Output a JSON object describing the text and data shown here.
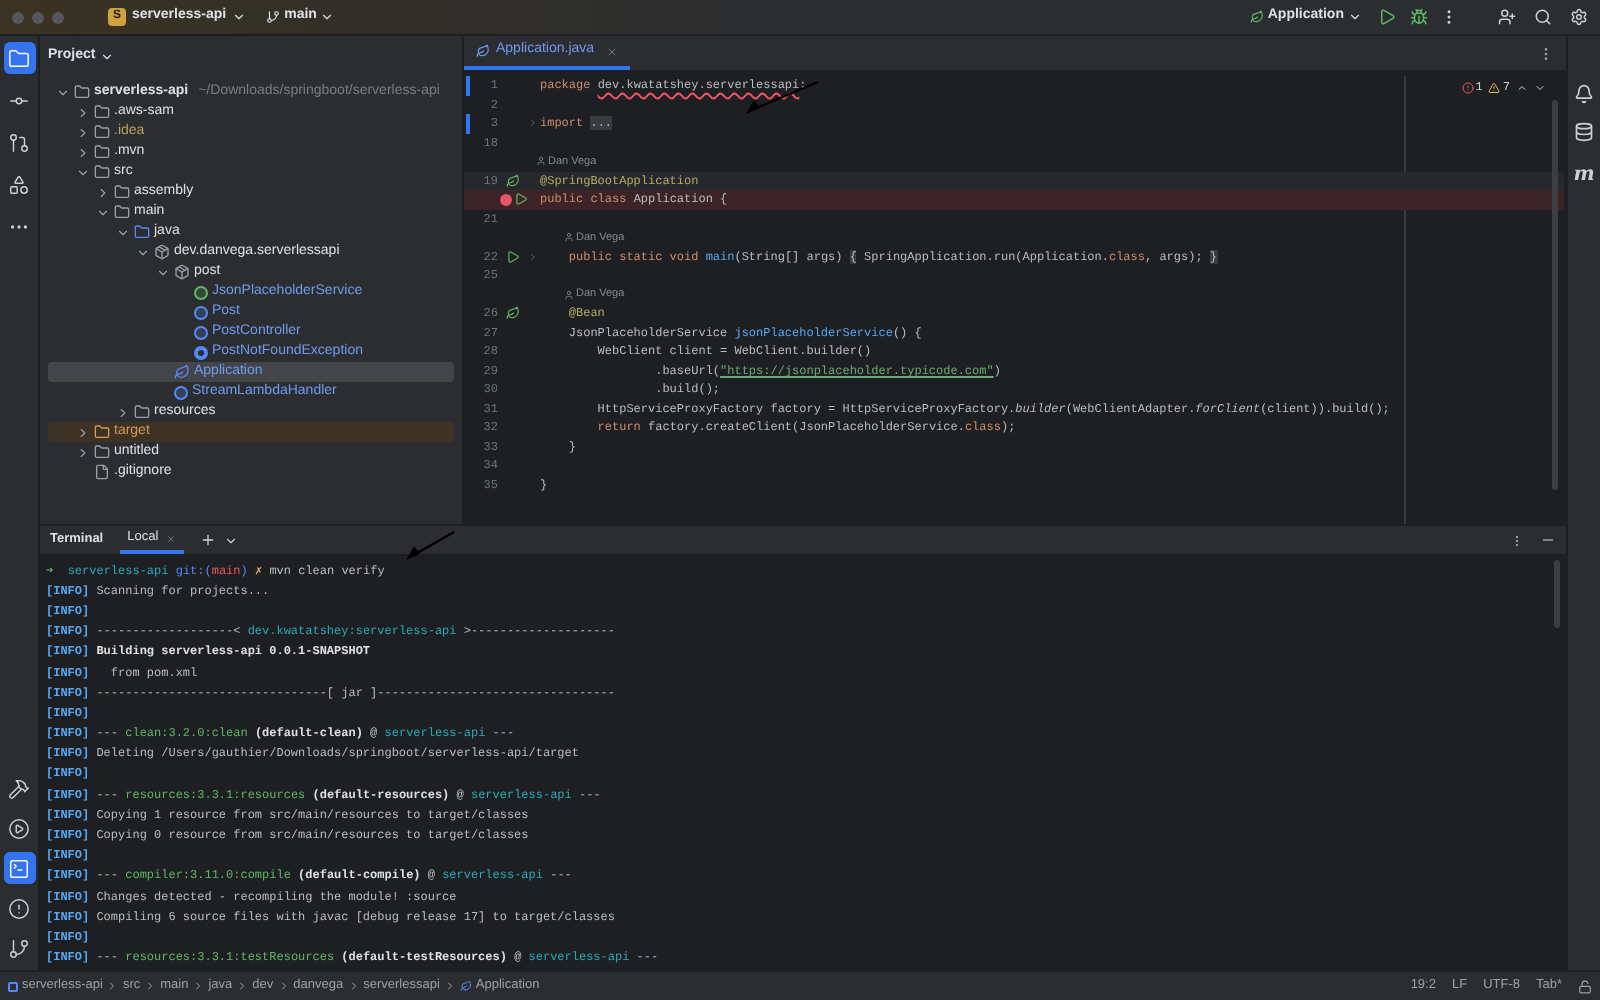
{
  "title_bar": {
    "project_badge": "S",
    "project": "serverless-api",
    "branch": "main",
    "run_config": "Application"
  },
  "left_strip": {
    "top": [
      {
        "kind": "project",
        "selected": true
      },
      {
        "kind": "commit",
        "selected": false
      },
      {
        "kind": "pull_requests",
        "selected": false
      },
      {
        "kind": "structure",
        "selected": false
      },
      {
        "kind": "more",
        "selected": false
      }
    ],
    "bottom": [
      {
        "kind": "build",
        "selected": false
      },
      {
        "kind": "services",
        "selected": false
      },
      {
        "kind": "terminal",
        "selected": true
      },
      {
        "kind": "problems",
        "selected": false
      },
      {
        "kind": "git",
        "selected": false
      }
    ]
  },
  "right_strip": {
    "items": [
      {
        "kind": "notifications"
      },
      {
        "kind": "database"
      },
      {
        "kind": "maven",
        "label": "m"
      }
    ]
  },
  "project": {
    "title": "Project",
    "tree": [
      {
        "label": "serverless-api",
        "kind": "module",
        "hint": "~/Downloads/springboot/serverless-api",
        "expanded": true,
        "selected": false,
        "color": "#dfe1e5",
        "children": [
          {
            "label": ".aws-sam",
            "kind": "folder",
            "expanded": false,
            "selected": false,
            "color": "#dfe1e5"
          },
          {
            "label": ".idea",
            "kind": "folder",
            "expanded": false,
            "selected": false,
            "color": "#b5a55e"
          },
          {
            "label": ".mvn",
            "kind": "folder",
            "expanded": false,
            "selected": false,
            "color": "#dfe1e5"
          },
          {
            "label": "src",
            "kind": "folder",
            "expanded": true,
            "selected": false,
            "color": "#dfe1e5",
            "children": [
              {
                "label": "assembly",
                "kind": "folder",
                "expanded": false,
                "selected": false,
                "color": "#dfe1e5"
              },
              {
                "label": "main",
                "kind": "folder",
                "expanded": true,
                "selected": false,
                "color": "#dfe1e5",
                "children": [
                  {
                    "label": "java",
                    "kind": "source_folder",
                    "expanded": true,
                    "selected": false,
                    "color": "#dfe1e5",
                    "children": [
                      {
                        "label": "dev.danvega.serverlessapi",
                        "kind": "package",
                        "expanded": true,
                        "selected": false,
                        "color": "#dfe1e5",
                        "children": [
                          {
                            "label": "post",
                            "kind": "package",
                            "expanded": true,
                            "selected": false,
                            "color": "#dfe1e5",
                            "children": [
                              {
                                "label": "JsonPlaceholderService",
                                "kind": "interface",
                                "selected": false,
                                "color": "#6f9cf0"
                              },
                              {
                                "label": "Post",
                                "kind": "class",
                                "selected": false,
                                "color": "#6f9cf0"
                              },
                              {
                                "label": "PostController",
                                "kind": "class",
                                "selected": false,
                                "color": "#6f9cf0"
                              },
                              {
                                "label": "PostNotFoundException",
                                "kind": "exception",
                                "selected": false,
                                "color": "#6f9cf0"
                              }
                            ]
                          },
                          {
                            "label": "Application",
                            "kind": "spring_class",
                            "selected": true,
                            "color": "#6f9cf0"
                          },
                          {
                            "label": "StreamLambdaHandler",
                            "kind": "class",
                            "selected": false,
                            "color": "#6f9cf0"
                          }
                        ]
                      }
                    ]
                  },
                  {
                    "label": "resources",
                    "kind": "resource_folder",
                    "expanded": false,
                    "selected": false,
                    "color": "#dfe1e5"
                  }
                ]
              }
            ]
          },
          {
            "label": "target",
            "kind": "excluded_folder",
            "expanded": false,
            "selected": false,
            "color": "#d29a5c"
          },
          {
            "label": "untitled",
            "kind": "folder",
            "expanded": false,
            "selected": false,
            "color": "#dfe1e5"
          },
          {
            "label": ".gitignore",
            "kind": "ignore_file",
            "selected": false,
            "color": "#dfe1e5"
          }
        ]
      }
    ]
  },
  "editor": {
    "tabs": [
      {
        "label": "Application.java",
        "selected": true
      }
    ],
    "errors": "1",
    "warnings": "7",
    "lines": [
      {
        "kind": "code",
        "number": "1",
        "marks": [
          {
            "kind": "changed"
          }
        ],
        "segments": [
          {
            "kind": "kw",
            "t": "package "
          },
          {
            "kind": "error",
            "t": "dev.kwatatshey.serverlessapi"
          },
          {
            "kind": "plain",
            "t": ";"
          }
        ]
      },
      {
        "kind": "code",
        "number": "2"
      },
      {
        "kind": "code",
        "number": "3",
        "marks": [
          {
            "kind": "changed"
          },
          {
            "kind": "fold"
          }
        ],
        "segments": [
          {
            "kind": "kw",
            "t": "import "
          },
          {
            "kind": "folded",
            "t": "..."
          }
        ]
      },
      {
        "kind": "code",
        "number": "18"
      },
      {
        "kind": "author",
        "nested": false,
        "text": "Dan Vega"
      },
      {
        "kind": "current_line",
        "number": "19",
        "marks": [
          {
            "kind": "spring"
          }
        ],
        "segments": [
          {
            "kind": "annotation",
            "t": "@SpringBootApplication"
          }
        ]
      },
      {
        "kind": "error_line",
        "marks": [
          {
            "kind": "breakpoint"
          },
          {
            "kind": "run"
          }
        ],
        "segments": [
          {
            "kind": "kw",
            "t": "public class "
          },
          {
            "kind": "plain",
            "t": "Application {"
          }
        ]
      },
      {
        "kind": "code",
        "number": "21"
      },
      {
        "kind": "author",
        "nested": true,
        "text": "Dan Vega"
      },
      {
        "kind": "code",
        "number": "22",
        "marks": [
          {
            "kind": "run"
          },
          {
            "kind": "fold"
          }
        ],
        "segments": [
          {
            "kind": "kw",
            "t": "    public static void "
          },
          {
            "kind": "method",
            "t": "main"
          },
          {
            "kind": "plain",
            "t": "(String[] args) "
          },
          {
            "kind": "folded",
            "t": "{"
          },
          {
            "kind": "plain",
            "t": " SpringApplication.run(Application."
          },
          {
            "kind": "kw",
            "t": "class"
          },
          {
            "kind": "plain",
            "t": ", args); "
          },
          {
            "kind": "folded",
            "t": "}"
          }
        ]
      },
      {
        "kind": "code",
        "number": "25"
      },
      {
        "kind": "author",
        "nested": true,
        "text": "Dan Vega"
      },
      {
        "kind": "code",
        "number": "26",
        "marks": [
          {
            "kind": "bean"
          }
        ],
        "segments": [
          {
            "kind": "annotation",
            "t": "    @Bean"
          }
        ]
      },
      {
        "kind": "code",
        "number": "27",
        "segments": [
          {
            "kind": "plain",
            "t": "    JsonPlaceholderService "
          },
          {
            "kind": "method",
            "t": "jsonPlaceholderService"
          },
          {
            "kind": "plain",
            "t": "() {"
          }
        ]
      },
      {
        "kind": "code",
        "number": "28",
        "segments": [
          {
            "kind": "plain",
            "t": "        WebClient client = WebClient.builder()"
          }
        ]
      },
      {
        "kind": "code",
        "number": "29",
        "segments": [
          {
            "kind": "plain",
            "t": "                .baseUrl("
          },
          {
            "kind": "string",
            "t": "\"https://jsonplaceholder.typicode.com\""
          },
          {
            "kind": "plain",
            "t": ")"
          }
        ]
      },
      {
        "kind": "code",
        "number": "30",
        "segments": [
          {
            "kind": "plain",
            "t": "                .build();"
          }
        ]
      },
      {
        "kind": "code",
        "number": "31",
        "segments": [
          {
            "kind": "plain",
            "t": "        HttpServiceProxyFactory factory = HttpServiceProxyFactory."
          },
          {
            "kind": "italic",
            "t": "builder"
          },
          {
            "kind": "plain",
            "t": "(WebClientAdapter."
          },
          {
            "kind": "italic",
            "t": "forClient"
          },
          {
            "kind": "plain",
            "t": "(client)).build();"
          }
        ]
      },
      {
        "kind": "code",
        "number": "32",
        "segments": [
          {
            "kind": "kw",
            "t": "        return "
          },
          {
            "kind": "plain",
            "t": "factory.createClient(JsonPlaceholderService."
          },
          {
            "kind": "kw",
            "t": "class"
          },
          {
            "kind": "plain",
            "t": ");"
          }
        ]
      },
      {
        "kind": "code",
        "number": "33",
        "segments": [
          {
            "kind": "plain",
            "t": "    }"
          }
        ]
      },
      {
        "kind": "code",
        "number": "34"
      },
      {
        "kind": "code",
        "number": "35",
        "segments": [
          {
            "kind": "plain",
            "t": "}"
          }
        ]
      }
    ]
  },
  "terminal": {
    "title": "Terminal",
    "tabs": [
      {
        "label": "Local",
        "selected": true
      }
    ],
    "lines": [
      [
        {
          "kind": "arrow",
          "t": "➜  "
        },
        {
          "kind": "teal",
          "t": "serverless-api "
        },
        {
          "kind": "blue",
          "t": "git:("
        },
        {
          "kind": "red",
          "t": "main"
        },
        {
          "kind": "blue",
          "t": ") "
        },
        {
          "kind": "yellow",
          "t": "✗ "
        },
        {
          "kind": "plain",
          "t": "mvn clean verify"
        }
      ],
      [
        {
          "kind": "info",
          "t": "[INFO]"
        },
        {
          "kind": "plain",
          "t": " Scanning for projects..."
        }
      ],
      [
        {
          "kind": "info",
          "t": "[INFO]"
        }
      ],
      [
        {
          "kind": "info",
          "t": "[INFO]"
        },
        {
          "kind": "plain",
          "t": " -------------------< "
        },
        {
          "kind": "teal",
          "t": "dev.kwatatshey:serverless-api"
        },
        {
          "kind": "plain",
          "t": " >--------------------"
        }
      ],
      [
        {
          "kind": "info",
          "t": "[INFO]"
        },
        {
          "kind": "bold",
          "t": " Building serverless-api 0.0.1-SNAPSHOT"
        }
      ],
      [
        {
          "kind": "info",
          "t": "[INFO]"
        },
        {
          "kind": "plain",
          "t": "   from pom.xml"
        }
      ],
      [
        {
          "kind": "info",
          "t": "[INFO]"
        },
        {
          "kind": "plain",
          "t": " --------------------------------[ jar ]---------------------------------"
        }
      ],
      [
        {
          "kind": "info",
          "t": "[INFO]"
        }
      ],
      [
        {
          "kind": "info",
          "t": "[INFO]"
        },
        {
          "kind": "plain",
          "t": " --- "
        },
        {
          "kind": "green",
          "t": "clean:3.2.0:clean"
        },
        {
          "kind": "bold",
          "t": " (default-clean)"
        },
        {
          "kind": "plain",
          "t": " @ "
        },
        {
          "kind": "teal",
          "t": "serverless-api"
        },
        {
          "kind": "plain",
          "t": " ---"
        }
      ],
      [
        {
          "kind": "info",
          "t": "[INFO]"
        },
        {
          "kind": "plain",
          "t": " Deleting /Users/gauthier/Downloads/springboot/serverless-api/target"
        }
      ],
      [
        {
          "kind": "info",
          "t": "[INFO]"
        }
      ],
      [
        {
          "kind": "info",
          "t": "[INFO]"
        },
        {
          "kind": "plain",
          "t": " --- "
        },
        {
          "kind": "green",
          "t": "resources:3.3.1:resources"
        },
        {
          "kind": "bold",
          "t": " (default-resources)"
        },
        {
          "kind": "plain",
          "t": " @ "
        },
        {
          "kind": "teal",
          "t": "serverless-api"
        },
        {
          "kind": "plain",
          "t": " ---"
        }
      ],
      [
        {
          "kind": "info",
          "t": "[INFO]"
        },
        {
          "kind": "plain",
          "t": " Copying 1 resource from src/main/resources to target/classes"
        }
      ],
      [
        {
          "kind": "info",
          "t": "[INFO]"
        },
        {
          "kind": "plain",
          "t": " Copying 0 resource from src/main/resources to target/classes"
        }
      ],
      [
        {
          "kind": "info",
          "t": "[INFO]"
        }
      ],
      [
        {
          "kind": "info",
          "t": "[INFO]"
        },
        {
          "kind": "plain",
          "t": " --- "
        },
        {
          "kind": "green",
          "t": "compiler:3.11.0:compile"
        },
        {
          "kind": "bold",
          "t": " (default-compile)"
        },
        {
          "kind": "plain",
          "t": " @ "
        },
        {
          "kind": "teal",
          "t": "serverless-api"
        },
        {
          "kind": "plain",
          "t": " ---"
        }
      ],
      [
        {
          "kind": "info",
          "t": "[INFO]"
        },
        {
          "kind": "plain",
          "t": " Changes detected - recompiling the module! :source"
        }
      ],
      [
        {
          "kind": "info",
          "t": "[INFO]"
        },
        {
          "kind": "plain",
          "t": " Compiling 6 source files with javac [debug release 17] to target/classes"
        }
      ],
      [
        {
          "kind": "info",
          "t": "[INFO]"
        }
      ],
      [
        {
          "kind": "info",
          "t": "[INFO]"
        },
        {
          "kind": "plain",
          "t": " --- "
        },
        {
          "kind": "green",
          "t": "resources:3.3.1:testResources"
        },
        {
          "kind": "bold",
          "t": " (default-testResources)"
        },
        {
          "kind": "plain",
          "t": " @ "
        },
        {
          "kind": "teal",
          "t": "serverless-api"
        },
        {
          "kind": "plain",
          "t": " ---"
        }
      ]
    ]
  },
  "status_bar": {
    "breadcrumbs": [
      {
        "label": "serverless-api",
        "kind": "module"
      },
      {
        "label": "src",
        "kind": "plain"
      },
      {
        "label": "main",
        "kind": "plain"
      },
      {
        "label": "java",
        "kind": "plain"
      },
      {
        "label": "dev",
        "kind": "plain"
      },
      {
        "label": "danvega",
        "kind": "plain"
      },
      {
        "label": "serverlessapi",
        "kind": "plain"
      },
      {
        "label": "Application",
        "kind": "spring_class"
      }
    ],
    "position": "19:2",
    "line_ending": "LF",
    "encoding": "UTF-8",
    "indent": "Tab*"
  }
}
